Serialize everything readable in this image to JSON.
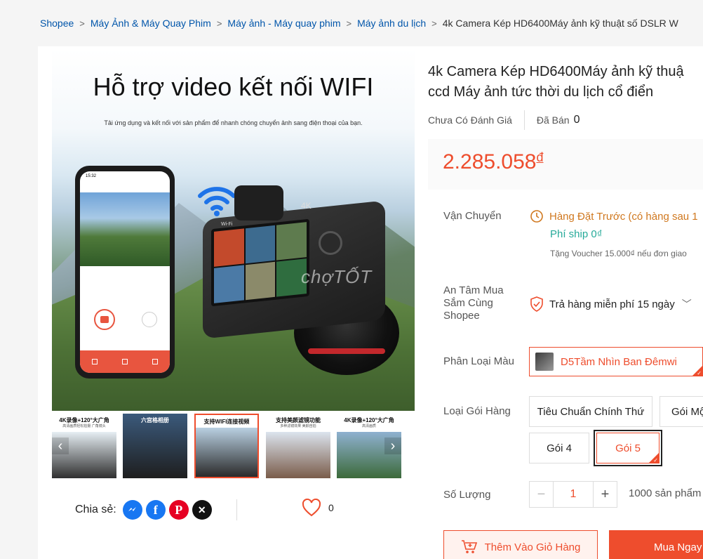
{
  "breadcrumb": {
    "items": [
      "Shopee",
      "Máy Ảnh & Máy Quay Phim",
      "Máy ảnh - Máy quay phim",
      "Máy ảnh du lịch"
    ],
    "current": "4k Camera Kép HD6400Máy ảnh kỹ thuật số DSLR W",
    "separator": ">"
  },
  "main_image": {
    "headline": "Hỗ trợ video kết nối WIFI",
    "subtext": "Tải ứng dụng và kết nối với sản phẩm để nhanh chóng chuyển ảnh sang điện thoại của bạn.",
    "phone_time": "15:32",
    "camera_label_4k": "4K",
    "camera_label_wifi": "Wi-Fi",
    "watermark": "chợTỐT"
  },
  "thumbnails": [
    {
      "caption": "4K录像+120°大广角",
      "sub": "高清画质轻松拍摄 广角镜头",
      "color1": "#e6eef3",
      "color2": "#2f2f2f",
      "active": false
    },
    {
      "caption": "六宫格相册",
      "sub": "",
      "color1": "#3b5a7c",
      "color2": "#1e1e1e",
      "active": false
    },
    {
      "caption": "支持WIFI连接视频",
      "sub": "",
      "color1": "#b9d0e2",
      "color2": "#2a2a2a",
      "active": true
    },
    {
      "caption": "支持美颜滤镜功能",
      "sub": "多种滤镜效果 美颜自拍",
      "color1": "#dce4ee",
      "color2": "#7a5c4a",
      "active": false
    },
    {
      "caption": "4K录像+120°大广角",
      "sub": "高清画质",
      "color1": "#8fb1d0",
      "color2": "#3c6a3a",
      "active": false
    }
  ],
  "share": {
    "label": "Chia sẻ:",
    "icons": [
      "messenger-icon",
      "facebook-icon",
      "pinterest-icon",
      "x-icon"
    ]
  },
  "favorite": {
    "count": "0"
  },
  "product": {
    "title_line1": "4k Camera Kép HD6400Máy ảnh kỹ thuậ",
    "title_line2": "ccd Máy ảnh tức thời du lịch cổ điển",
    "rating_text": "Chưa Có Đánh Giá",
    "sold_label": "Đã Bán",
    "sold_count": "0",
    "price": "2.285.058",
    "currency": "đ"
  },
  "shipping": {
    "label": "Vận Chuyển",
    "preorder": "Hàng Đặt Trước (có hàng sau 1",
    "fee": "Phí ship 0₫",
    "voucher": "Tặng Voucher 15.000₫ nếu đơn giao"
  },
  "guarantee": {
    "label_lines": [
      "An Tâm Mua",
      "Sắm Cùng",
      "Shopee"
    ],
    "text": "Trả hàng miễn phí 15 ngày"
  },
  "color_variant": {
    "label": "Phân Loại Màu",
    "selected": "D5Tầm Nhìn Ban Đêmwi"
  },
  "package": {
    "label": "Loại Gói Hàng",
    "options": [
      "Tiêu Chuẩn Chính Thứ",
      "Gói Mộ",
      "Gói 4",
      "Gói 5"
    ],
    "selected": "Gói 5"
  },
  "quantity": {
    "label": "Số Lượng",
    "value": "1",
    "minus": "−",
    "plus": "+",
    "stock": "1000 sản phẩm"
  },
  "actions": {
    "add_to_cart": "Thêm Vào Giỏ Hàng",
    "buy_now": "Mua Ngay"
  },
  "colors": {
    "accent": "#ee4d2d",
    "link": "#0055aa",
    "shipping_green": "#26aa99",
    "preorder_orange": "#d0781f"
  }
}
